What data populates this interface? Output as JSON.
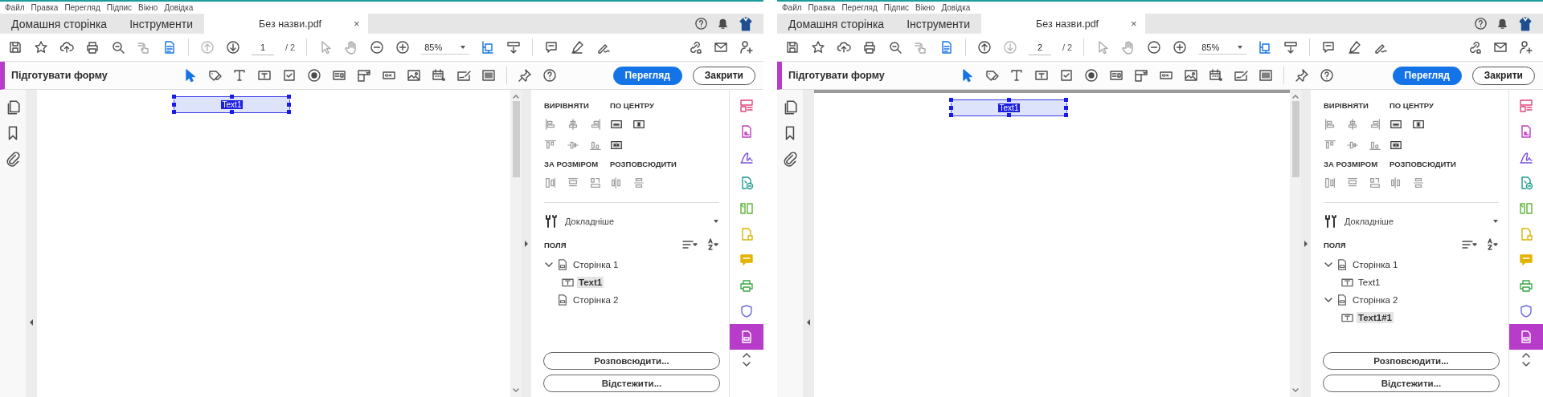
{
  "windows": [
    {
      "menu": [
        "Файл",
        "Правка",
        "Перегляд",
        "Підпис",
        "Вікно",
        "Довідка"
      ],
      "tabs": [
        {
          "label": "Домашня сторінка",
          "selected": false
        },
        {
          "label": "Інструменти",
          "selected": false
        },
        {
          "label": "Без назви.pdf",
          "selected": true,
          "close": "×"
        }
      ],
      "page_nav": [
        {
          "kind": "up",
          "disabled": true
        },
        {
          "kind": "down",
          "disabled": false
        }
      ],
      "page_current": "1",
      "page_total": "/ 2",
      "zoom": "85%",
      "form_title": "Підготувати форму",
      "actions": [
        {
          "label": "Перегляд",
          "kind": "primary"
        },
        {
          "label": "Закрити",
          "kind": "secondary"
        }
      ],
      "canvas_field": {
        "label": "Text1",
        "selected": true
      },
      "panel": {
        "sections": [
          "ВИРІВНЯТИ",
          "ПО ЦЕНТРУ",
          "ЗА РОЗМІРОМ",
          "РОЗПОВСЮДИТИ"
        ],
        "more": "Докладніше",
        "fields_title": "ПОЛЯ",
        "fields": [
          {
            "label": "Сторінка 1",
            "expanded": true,
            "selected": false,
            "children": [
              {
                "label": "Text1",
                "selected": true
              }
            ]
          },
          {
            "label": "Сторінка 2",
            "selected": false
          }
        ],
        "buttons": [
          "Розповсюдити...",
          "Відстежити..."
        ]
      },
      "rail_tools": [
        {
          "kind": "form",
          "selected": false
        },
        {
          "kind": "export",
          "selected": false
        },
        {
          "kind": "sign",
          "selected": false
        },
        {
          "kind": "create",
          "selected": false
        },
        {
          "kind": "organize",
          "selected": false
        },
        {
          "kind": "edit",
          "selected": false
        },
        {
          "kind": "comment",
          "selected": false
        },
        {
          "kind": "print",
          "selected": false
        },
        {
          "kind": "protect",
          "selected": false
        },
        {
          "kind": "prepare",
          "selected": true
        }
      ]
    },
    {
      "menu": [
        "Файл",
        "Правка",
        "Перегляд",
        "Підпис",
        "Вікно",
        "Довідка"
      ],
      "tabs": [
        {
          "label": "Домашня сторінка",
          "selected": false
        },
        {
          "label": "Інструменти",
          "selected": false
        },
        {
          "label": "Без назви.pdf",
          "selected": true,
          "close": "×"
        }
      ],
      "page_nav": [
        {
          "kind": "up",
          "disabled": false
        },
        {
          "kind": "down",
          "disabled": true
        }
      ],
      "page_current": "2",
      "page_total": "/ 2",
      "zoom": "85%",
      "form_title": "Підготувати форму",
      "actions": [
        {
          "label": "Перегляд",
          "kind": "primary"
        },
        {
          "label": "Закрити",
          "kind": "secondary"
        }
      ],
      "canvas_field": {
        "label": "Text1",
        "selected": true
      },
      "panel": {
        "sections": [
          "ВИРІВНЯТИ",
          "ПО ЦЕНТРУ",
          "ЗА РОЗМІРОМ",
          "РОЗПОВСЮДИТИ"
        ],
        "more": "Докладніше",
        "fields_title": "ПОЛЯ",
        "fields": [
          {
            "label": "Сторінка 1",
            "expanded": true,
            "selected": false,
            "children": [
              {
                "label": "Text1",
                "selected": false
              }
            ]
          },
          {
            "label": "Сторінка 2",
            "expanded": true,
            "selected": false,
            "children": [
              {
                "label": "Text1#1",
                "selected": true
              }
            ]
          }
        ],
        "buttons": [
          "Розповсюдити...",
          "Відстежити..."
        ]
      },
      "rail_tools": [
        {
          "kind": "form",
          "selected": false
        },
        {
          "kind": "export",
          "selected": false
        },
        {
          "kind": "sign",
          "selected": false
        },
        {
          "kind": "create",
          "selected": false
        },
        {
          "kind": "organize",
          "selected": false
        },
        {
          "kind": "edit",
          "selected": false
        },
        {
          "kind": "comment",
          "selected": false
        },
        {
          "kind": "print",
          "selected": false
        },
        {
          "kind": "protect",
          "selected": false
        },
        {
          "kind": "prepare",
          "selected": true
        }
      ]
    }
  ]
}
